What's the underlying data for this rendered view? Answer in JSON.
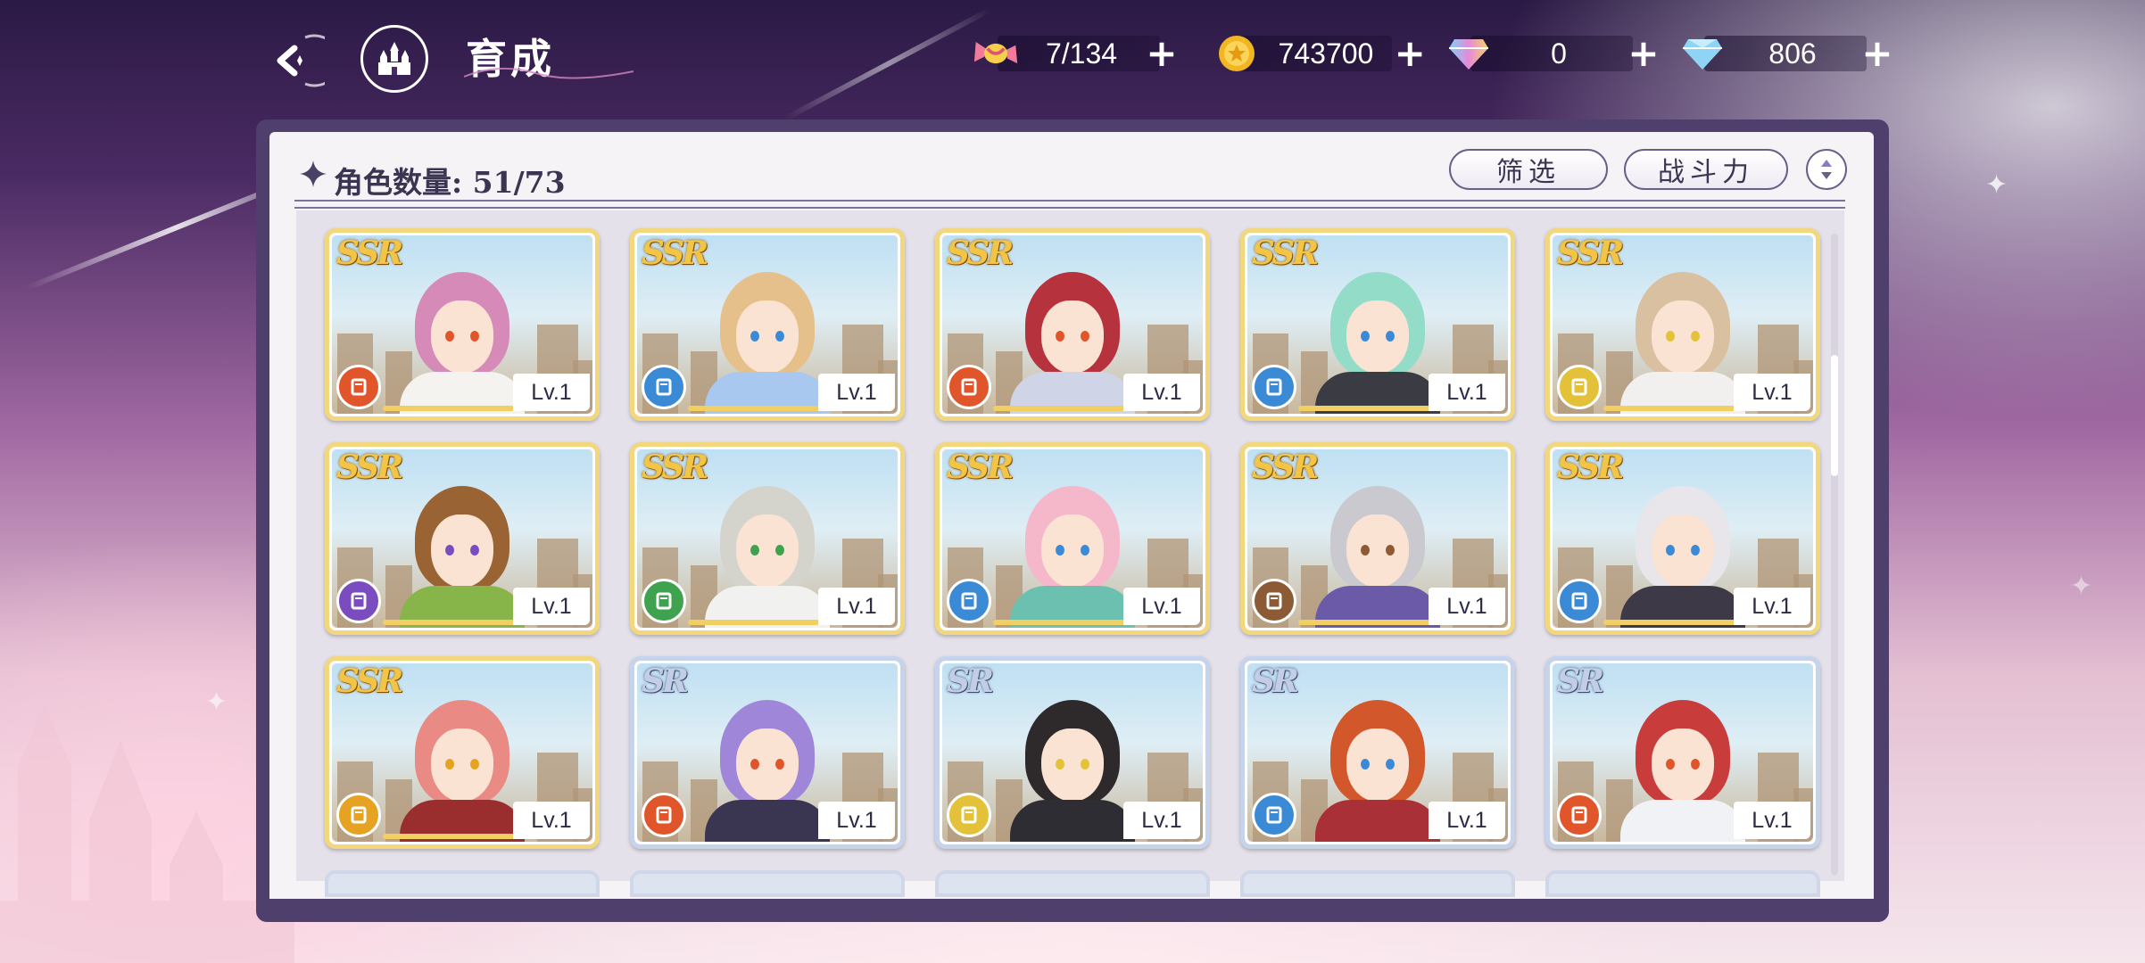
{
  "header": {
    "title": "育成",
    "back_icon": "back-arrow-icon",
    "home_icon": "castle-home-icon"
  },
  "resources": [
    {
      "name": "candy",
      "icon": "candy-icon",
      "value": "7/134"
    },
    {
      "name": "gold",
      "icon": "gold-coin-icon",
      "value": "743700"
    },
    {
      "name": "rainbow-gem",
      "icon": "rainbow-diamond-icon",
      "value": "0"
    },
    {
      "name": "diamond",
      "icon": "blue-diamond-icon",
      "value": "806"
    }
  ],
  "panel": {
    "count_label": "角色数量: 51/73",
    "filter_label": "筛选",
    "sort_label": "战斗力",
    "order_icon": "sort-order-icon"
  },
  "cards": [
    {
      "rarity": "SSR",
      "level": "Lv.1",
      "class_color": "#e0552a",
      "class_icon": "book-icon",
      "hair": "#d58ab8",
      "outfit": "#f5f3f0"
    },
    {
      "rarity": "SSR",
      "level": "Lv.1",
      "class_color": "#3b8ad6",
      "class_icon": "staff-icon",
      "hair": "#e5c08a",
      "outfit": "#a8c8ef"
    },
    {
      "rarity": "SSR",
      "level": "Lv.1",
      "class_color": "#e0552a",
      "class_icon": "book-icon",
      "hair": "#b6323d",
      "outfit": "#cfd4e6"
    },
    {
      "rarity": "SSR",
      "level": "Lv.1",
      "class_color": "#3b8ad6",
      "class_icon": "boot-icon",
      "hair": "#93dcc8",
      "outfit": "#3b3b44"
    },
    {
      "rarity": "SSR",
      "level": "Lv.1",
      "class_color": "#e3c23a",
      "class_icon": "staff-icon",
      "hair": "#d8c0a0",
      "outfit": "#f2f0ee"
    },
    {
      "rarity": "SSR",
      "level": "Lv.1",
      "class_color": "#7b4cc0",
      "class_icon": "book-icon",
      "hair": "#9a6334",
      "outfit": "#87b54a"
    },
    {
      "rarity": "SSR",
      "level": "Lv.1",
      "class_color": "#3fa24e",
      "class_icon": "staff-icon",
      "hair": "#d4d4cc",
      "outfit": "#f1f1ef"
    },
    {
      "rarity": "SSR",
      "level": "Lv.1",
      "class_color": "#3b8ad6",
      "class_icon": "staff-icon",
      "hair": "#f5b8cb",
      "outfit": "#6cc0b0"
    },
    {
      "rarity": "SSR",
      "level": "Lv.1",
      "class_color": "#8c5a34",
      "class_icon": "shield-icon",
      "hair": "#c9c9cf",
      "outfit": "#6a5aa8"
    },
    {
      "rarity": "SSR",
      "level": "Lv.1",
      "class_color": "#3b8ad6",
      "class_icon": "boot-icon",
      "hair": "#e8e6ea",
      "outfit": "#3d3947"
    },
    {
      "rarity": "SSR",
      "level": "Lv.1",
      "class_color": "#e6a323",
      "class_icon": "shield-icon",
      "hair": "#e98a84",
      "outfit": "#9a2e2e"
    },
    {
      "rarity": "SR",
      "level": "Lv.1",
      "class_color": "#e0552a",
      "class_icon": "staff-icon",
      "hair": "#9f86d8",
      "outfit": "#3a3550"
    },
    {
      "rarity": "SR",
      "level": "Lv.1",
      "class_color": "#e3c23a",
      "class_icon": "staff-icon",
      "hair": "#2e2a2c",
      "outfit": "#2f2d34"
    },
    {
      "rarity": "SR",
      "level": "Lv.1",
      "class_color": "#3b8ad6",
      "class_icon": "fist-icon",
      "hair": "#d2582c",
      "outfit": "#a83036"
    },
    {
      "rarity": "SR",
      "level": "Lv.1",
      "class_color": "#e0552a",
      "class_icon": "fist-icon",
      "hair": "#c83c3c",
      "outfit": "#f0f2f6"
    }
  ]
}
